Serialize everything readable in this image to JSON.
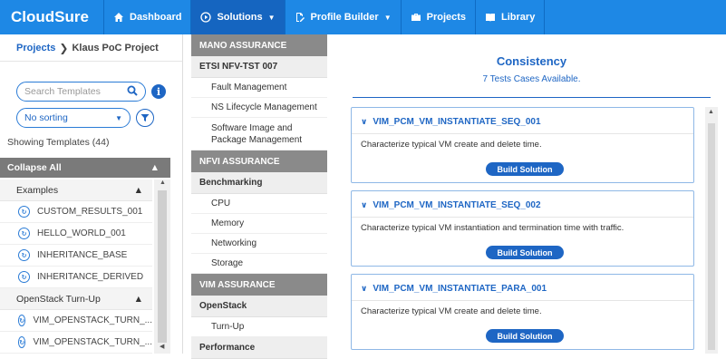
{
  "app": {
    "title": "CloudSure"
  },
  "nav": [
    {
      "label": "Dashboard",
      "icon": "home-icon"
    },
    {
      "label": "Solutions",
      "icon": "play-circle-icon",
      "active": true
    },
    {
      "label": "Profile Builder",
      "icon": "profile-edit-icon"
    },
    {
      "label": "Projects",
      "icon": "briefcase-icon"
    },
    {
      "label": "Library",
      "icon": "book-icon"
    }
  ],
  "breadcrumb": {
    "root": "Projects",
    "current": "Klaus PoC Project"
  },
  "search": {
    "placeholder": "Search Templates"
  },
  "sort": {
    "value": "No sorting"
  },
  "showing": "Showing Templates (44)",
  "collapse": "Collapse All",
  "tree": [
    {
      "group": "Examples",
      "items": [
        "CUSTOM_RESULTS_001",
        "HELLO_WORLD_001",
        "INHERITANCE_BASE",
        "INHERITANCE_DERIVED"
      ]
    },
    {
      "group": "OpenStack Turn-Up",
      "items": [
        "VIM_OPENSTACK_TURN_...",
        "VIM_OPENSTACK_TURN_..."
      ]
    }
  ],
  "menu": {
    "mano": "MANO ASSURANCE",
    "etsi": "ETSI NFV-TST 007",
    "etsi_items": [
      "Fault Management",
      "NS Lifecycle Management",
      "Software Image and Package Management"
    ],
    "nfvi": "NFVI ASSURANCE",
    "bench": "Benchmarking",
    "bench_items": [
      "CPU",
      "Memory",
      "Networking",
      "Storage"
    ],
    "vim": "VIM ASSURANCE",
    "openstack": "OpenStack",
    "openstack_items": [
      "Turn-Up"
    ],
    "perf": "Performance"
  },
  "content": {
    "title": "Consistency",
    "subtitle": "7 Tests Cases Available.",
    "build_label": "Build Solution",
    "tests": [
      {
        "name": "VIM_PCM_VM_INSTANTIATE_SEQ_001",
        "desc": "Characterize typical VM create and delete time."
      },
      {
        "name": "VIM_PCM_VM_INSTANTIATE_SEQ_002",
        "desc": "Characterize typical VM instantiation and termination time with traffic."
      },
      {
        "name": "VIM_PCM_VM_INSTANTIATE_PARA_001",
        "desc": "Characterize typical VM create and delete time."
      }
    ]
  },
  "colors": {
    "primary": "#1e88e5",
    "accent": "#1e66c4",
    "section": "#8a8a8a"
  }
}
